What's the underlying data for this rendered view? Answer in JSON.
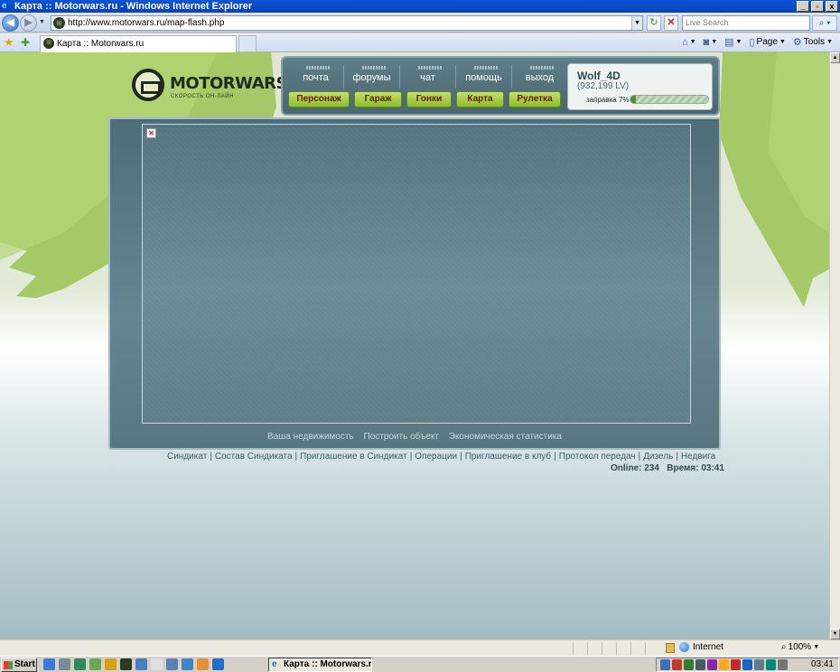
{
  "window": {
    "title": "Карта :: Motorwars.ru - Windows Internet Explorer",
    "controls": [
      "_",
      "▫",
      "x"
    ]
  },
  "address": {
    "url": "http://www.motorwars.ru/map-flash.php",
    "search_placeholder": "Live Search"
  },
  "tabs": {
    "active_tab": "Карта :: Motorwars.ru",
    "commands": {
      "page": "Page",
      "tools": "Tools"
    }
  },
  "site": {
    "logo_text": "MOTORWARS.RU",
    "logo_tagline": "скорость он-лайн",
    "top_links": [
      "почта",
      "форумы",
      "чат",
      "помощь",
      "выход"
    ],
    "green_buttons": [
      "Персонаж",
      "Гараж",
      "Гонки",
      "Карта",
      "Рулетка"
    ],
    "user": {
      "name": "Wolf_4D",
      "money": "(932,199 LV)",
      "fuel_label": "заправка 7%",
      "fuel_percent": 7
    },
    "panel_links": [
      "Ваша недвижимость",
      "Построить объект",
      "Экономическая статистика"
    ],
    "footer_links": [
      "Синдикат",
      "Состав Синдиката",
      "Приглашение в Синдикат",
      "Операции",
      "Приглашение в клуб",
      "Протокол передач",
      "Дизель",
      "Недвига"
    ],
    "online_label": "Online: 234",
    "time_label": "Время: 03:41"
  },
  "statusbar": {
    "zone": "Internet",
    "zoom": "100%"
  },
  "taskbar": {
    "start": "Start",
    "task": "Карта :: Motorwars.ru...",
    "clock": "03:41"
  },
  "colors": {
    "accent_green": "#8ebb2c",
    "panel_teal": "#5e7e88",
    "button_text": "#6e1414"
  }
}
